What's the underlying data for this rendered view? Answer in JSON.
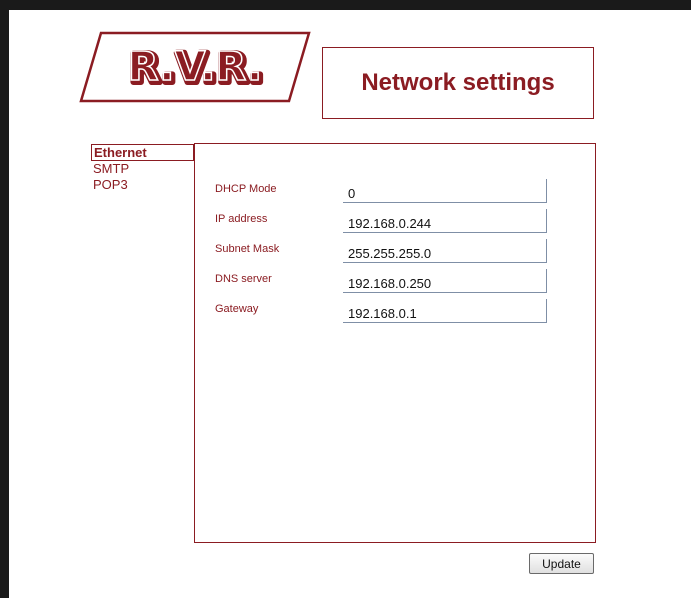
{
  "brand": {
    "logo_text": "R.V.R.",
    "color": "#8b1c22"
  },
  "header": {
    "title": "Network settings"
  },
  "nav": {
    "items": [
      {
        "label": "Ethernet",
        "active": true
      },
      {
        "label": "SMTP",
        "active": false
      },
      {
        "label": "POP3",
        "active": false
      }
    ]
  },
  "form": {
    "fields": [
      {
        "label": "DHCP Mode",
        "value": "0"
      },
      {
        "label": "IP address",
        "value": "192.168.0.244"
      },
      {
        "label": "Subnet Mask",
        "value": "255.255.255.0"
      },
      {
        "label": "DNS server",
        "value": "192.168.0.250"
      },
      {
        "label": "Gateway",
        "value": "192.168.0.1"
      }
    ]
  },
  "actions": {
    "update_label": "Update"
  }
}
